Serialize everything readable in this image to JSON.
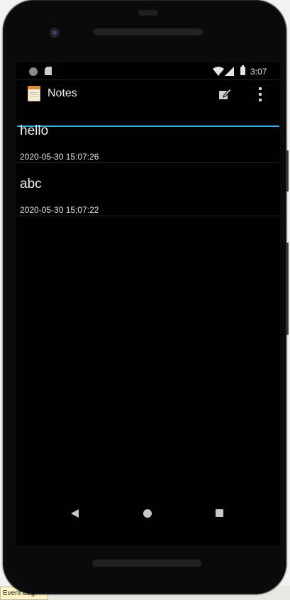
{
  "status_bar": {
    "time": "3:07",
    "icons": [
      "notification-dot-icon",
      "sd-card-icon",
      "wifi-icon",
      "cell-signal-icon",
      "battery-icon"
    ]
  },
  "action_bar": {
    "title": "Notes",
    "app_icon": "notepad-icon",
    "new_note_icon": "new-note-icon",
    "overflow_icon": "overflow-menu-icon",
    "accent_color": "#33b5e5"
  },
  "notes": [
    {
      "title": "hello",
      "date": "2020-05-30 15:07:26"
    },
    {
      "title": "abc",
      "date": "2020-05-30 15:07:22"
    }
  ],
  "nav_bar": {
    "back_icon": "back-icon",
    "home_icon": "home-icon",
    "recents_icon": "recents-icon"
  },
  "host_taskbar": {
    "item_label": "Event Log"
  }
}
